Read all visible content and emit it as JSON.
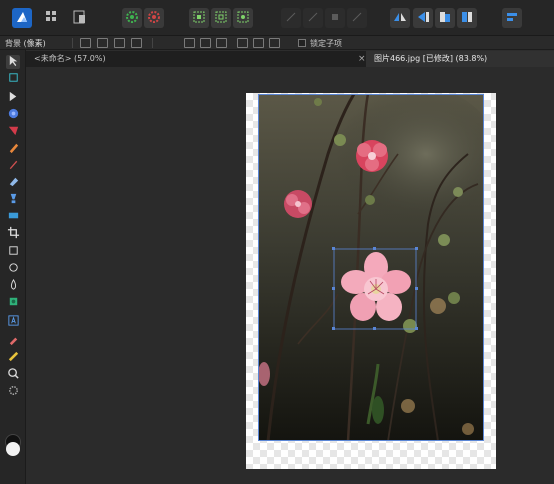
{
  "toolbar": {
    "buttons": [
      {
        "name": "affinity-photo-persona",
        "icon": "persona-photo-icon"
      },
      {
        "name": "liquify-persona",
        "icon": "liquify-icon"
      },
      {
        "name": "export-persona",
        "icon": "export-icon"
      },
      {
        "name": "develop-settings",
        "icon": "gear-icon"
      },
      {
        "name": "assistant",
        "icon": "gear-red-icon"
      },
      {
        "name": "selection-1",
        "icon": "selection-icon"
      },
      {
        "name": "selection-2",
        "icon": "selection-icon"
      },
      {
        "name": "selection-3",
        "icon": "selection-icon"
      },
      {
        "name": "disabled-1",
        "icon": "tool-icon"
      },
      {
        "name": "disabled-2",
        "icon": "tool-icon"
      },
      {
        "name": "disabled-3",
        "icon": "tool-icon"
      },
      {
        "name": "disabled-4",
        "icon": "tool-icon"
      },
      {
        "name": "flip-horizontal",
        "icon": "flip-h-icon"
      },
      {
        "name": "arrange-back",
        "icon": "arrange-icon"
      },
      {
        "name": "arrange-front",
        "icon": "arrange-icon"
      },
      {
        "name": "arrange-forward",
        "icon": "arrange-icon"
      },
      {
        "name": "align",
        "icon": "align-icon"
      }
    ]
  },
  "context_bar": {
    "layer_label": "背景 (像素)",
    "lock_children_label": "锁定子项"
  },
  "tabs": [
    {
      "label": "<未命名> (57.0%)",
      "active": false
    },
    {
      "label": "图片466.jpg [已修改] (83.8%)",
      "active": true
    }
  ],
  "tab_close_glyph": "×",
  "tools": [
    "move-tool-icon",
    "artboard-tool-icon",
    "view-tool-icon",
    "color-picker-icon",
    "fill-tool-icon",
    "pencil-icon",
    "brush-icon",
    "eraser-icon",
    "clone-icon",
    "gradient-icon",
    "crop-icon",
    "rectangle-icon",
    "ellipse-icon",
    "blur-icon",
    "sponge-icon",
    "text-tool-icon",
    "eyedropper-icon",
    "ruler-icon",
    "zoom-icon",
    "settings-icon"
  ],
  "colors": {
    "accent_blue": "#2f7ad8",
    "selection_blue": "#5a86d6",
    "green_gear": "#3fb34f",
    "red_gear": "#d04545",
    "flower_pink": "#f2a3b6"
  }
}
